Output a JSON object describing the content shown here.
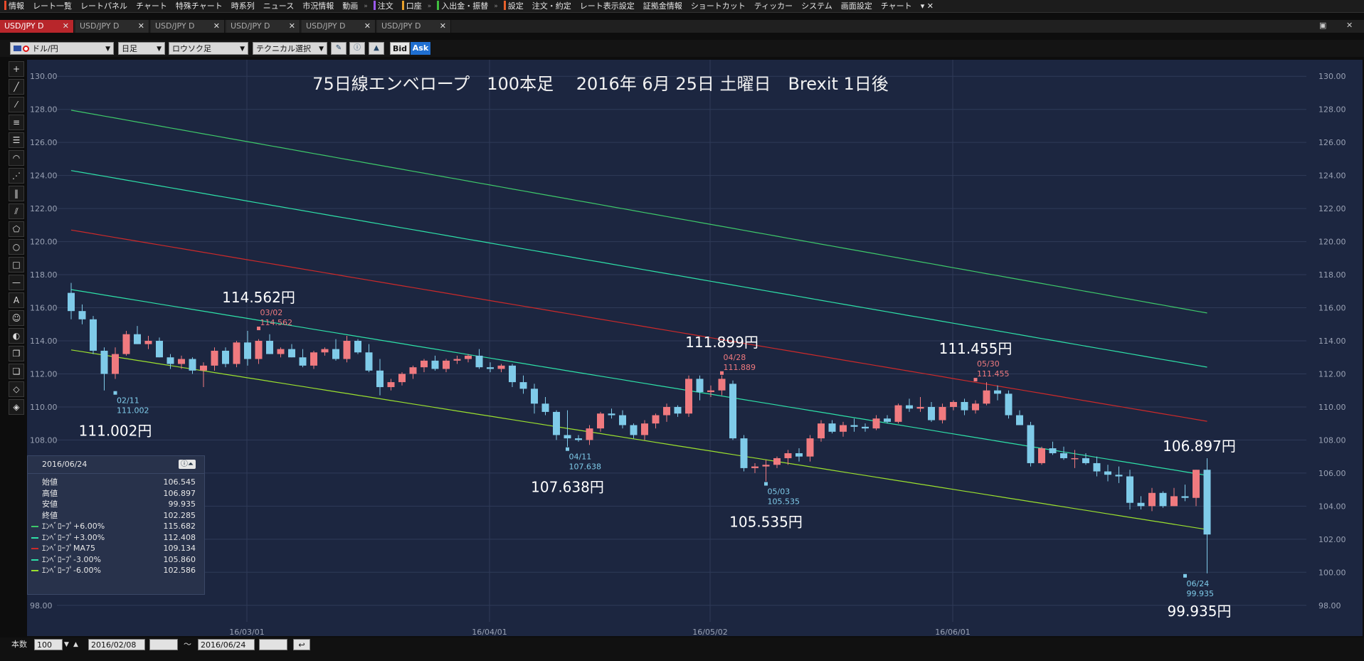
{
  "menubar": {
    "items": [
      {
        "label": "情報",
        "color": "#e84a2b"
      },
      {
        "label": "レート一覧",
        "color": ""
      },
      {
        "label": "レートパネル",
        "color": ""
      },
      {
        "label": "チャート",
        "color": ""
      },
      {
        "label": "特殊チャート",
        "color": ""
      },
      {
        "label": "時系列",
        "color": ""
      },
      {
        "label": "ニュース",
        "color": ""
      },
      {
        "label": "市況情報",
        "color": ""
      },
      {
        "label": "動画",
        "color": ""
      },
      {
        "label": "注文",
        "color": "#9b59f5"
      },
      {
        "label": "口座",
        "color": "#e8a02b"
      },
      {
        "label": "入出金・振替",
        "color": "#3fbf3f"
      },
      {
        "label": "設定",
        "color": "#e8602b"
      },
      {
        "label": "注文・約定",
        "color": ""
      },
      {
        "label": "レート表示設定",
        "color": ""
      },
      {
        "label": "証拠金情報",
        "color": ""
      },
      {
        "label": "ショートカット",
        "color": ""
      },
      {
        "label": "ティッカー",
        "color": ""
      },
      {
        "label": "システム",
        "color": ""
      },
      {
        "label": "画面設定",
        "color": ""
      },
      {
        "label": "チャート",
        "color": ""
      }
    ]
  },
  "tabs": [
    {
      "label": "USD/JPY D",
      "active": true
    },
    {
      "label": "USD/JPY D",
      "active": false
    },
    {
      "label": "USD/JPY D",
      "active": false
    },
    {
      "label": "USD/JPY D",
      "active": false
    },
    {
      "label": "USD/JPY D",
      "active": false
    },
    {
      "label": "USD/JPY D",
      "active": false
    }
  ],
  "toolbar": {
    "symbol": "ドル/円",
    "period": "日足",
    "chart_style": "ロウソク足",
    "technical": "テクニカル選択",
    "bid": "Bid",
    "ask": "Ask"
  },
  "colors": {
    "bull": "#f07a7f",
    "bear": "#7fcbe9",
    "ma": "#cc2a2a",
    "env_p6": "#3ec86a",
    "env_p3": "#2ee0a8",
    "env_m3": "#2ee0a8",
    "env_m6": "#9be02e"
  },
  "chart_data": {
    "type": "candlestick",
    "title": "75日線エンベロープ　100本足　 2016年 6月 25日 土曜日　Brexit 1日後",
    "ylim": [
      97.0,
      131.0
    ],
    "y_ticks": [
      "130.00",
      "128.00",
      "126.00",
      "124.00",
      "122.00",
      "120.00",
      "118.00",
      "116.00",
      "114.00",
      "112.00",
      "110.00",
      "108.00",
      "106.00",
      "104.00",
      "102.00",
      "100.00",
      "98.00"
    ],
    "x_ticks": [
      {
        "label": "16/03/01",
        "index": 16
      },
      {
        "label": "16/04/01",
        "index": 38
      },
      {
        "label": "16/05/02",
        "index": 58
      },
      {
        "label": "16/06/01",
        "index": 80
      }
    ],
    "candles": [
      [
        116.9,
        117.5,
        115.3,
        115.8
      ],
      [
        115.8,
        116.2,
        115.0,
        115.3
      ],
      [
        115.3,
        115.5,
        113.2,
        113.4
      ],
      [
        113.4,
        113.6,
        111.0,
        112.0
      ],
      [
        112.0,
        113.6,
        111.7,
        113.2
      ],
      [
        113.2,
        114.6,
        113.1,
        114.4
      ],
      [
        114.4,
        114.9,
        113.8,
        113.8
      ],
      [
        113.8,
        114.3,
        113.5,
        114.0
      ],
      [
        114.0,
        114.2,
        113.0,
        113.0
      ],
      [
        113.0,
        113.2,
        112.3,
        112.6
      ],
      [
        112.6,
        113.1,
        112.3,
        112.9
      ],
      [
        112.9,
        113.0,
        112.0,
        112.2
      ],
      [
        112.2,
        112.7,
        111.2,
        112.5
      ],
      [
        112.5,
        113.6,
        112.2,
        113.4
      ],
      [
        113.4,
        113.6,
        112.4,
        112.6
      ],
      [
        112.6,
        114.0,
        112.4,
        113.9
      ],
      [
        113.9,
        114.6,
        112.5,
        112.9
      ],
      [
        112.9,
        114.1,
        112.6,
        114.0
      ],
      [
        114.0,
        114.4,
        113.2,
        113.2
      ],
      [
        113.2,
        113.6,
        113.0,
        113.5
      ],
      [
        113.5,
        113.8,
        113.0,
        113.0
      ],
      [
        113.0,
        113.5,
        112.4,
        112.5
      ],
      [
        112.5,
        113.4,
        112.3,
        113.3
      ],
      [
        113.3,
        113.6,
        113.1,
        113.5
      ],
      [
        113.5,
        114.1,
        112.8,
        112.9
      ],
      [
        112.9,
        114.3,
        112.7,
        114.0
      ],
      [
        114.0,
        114.1,
        113.2,
        113.3
      ],
      [
        113.3,
        113.8,
        112.1,
        112.2
      ],
      [
        112.2,
        112.9,
        110.7,
        111.2
      ],
      [
        111.2,
        111.7,
        111.0,
        111.5
      ],
      [
        111.5,
        112.1,
        111.3,
        112.0
      ],
      [
        112.0,
        112.5,
        111.7,
        112.4
      ],
      [
        112.4,
        112.9,
        112.1,
        112.8
      ],
      [
        112.8,
        113.1,
        112.2,
        112.3
      ],
      [
        112.3,
        112.9,
        112.1,
        112.8
      ],
      [
        112.8,
        113.1,
        112.6,
        112.9
      ],
      [
        112.9,
        113.2,
        112.7,
        113.1
      ],
      [
        113.1,
        113.5,
        112.3,
        112.4
      ],
      [
        112.4,
        112.7,
        112.1,
        112.3
      ],
      [
        112.3,
        112.6,
        112.1,
        112.5
      ],
      [
        112.5,
        112.6,
        111.2,
        111.5
      ],
      [
        111.5,
        111.9,
        110.8,
        111.1
      ],
      [
        111.1,
        111.4,
        109.6,
        110.2
      ],
      [
        110.2,
        110.6,
        109.5,
        109.7
      ],
      [
        109.7,
        109.8,
        108.0,
        108.3
      ],
      [
        108.3,
        109.8,
        107.6,
        108.1
      ],
      [
        108.1,
        108.3,
        107.9,
        108.0
      ],
      [
        108.0,
        108.9,
        107.7,
        108.7
      ],
      [
        108.7,
        109.7,
        108.5,
        109.6
      ],
      [
        109.6,
        109.9,
        109.3,
        109.5
      ],
      [
        109.5,
        109.8,
        108.7,
        108.9
      ],
      [
        108.9,
        109.0,
        108.1,
        108.3
      ],
      [
        108.3,
        109.2,
        108.0,
        109.0
      ],
      [
        109.0,
        109.6,
        108.7,
        109.5
      ],
      [
        109.5,
        110.2,
        109.1,
        110.0
      ],
      [
        110.0,
        110.1,
        109.4,
        109.6
      ],
      [
        109.6,
        111.9,
        109.4,
        111.7
      ],
      [
        111.7,
        111.9,
        110.4,
        110.9
      ],
      [
        110.9,
        111.3,
        110.6,
        111.0
      ],
      [
        111.0,
        111.9,
        110.7,
        111.7
      ],
      [
        111.4,
        111.6,
        108.0,
        108.1
      ],
      [
        108.1,
        108.3,
        106.1,
        106.3
      ],
      [
        106.3,
        106.6,
        106.0,
        106.4
      ],
      [
        106.4,
        106.8,
        105.5,
        106.5
      ],
      [
        106.5,
        107.0,
        106.3,
        106.9
      ],
      [
        106.9,
        107.4,
        106.5,
        107.2
      ],
      [
        107.2,
        107.5,
        106.7,
        107.0
      ],
      [
        107.0,
        108.3,
        106.7,
        108.1
      ],
      [
        108.1,
        109.2,
        107.9,
        109.0
      ],
      [
        109.0,
        109.2,
        108.4,
        108.5
      ],
      [
        108.5,
        109.1,
        108.2,
        108.9
      ],
      [
        108.9,
        109.3,
        108.5,
        108.8
      ],
      [
        108.8,
        109.0,
        108.5,
        108.7
      ],
      [
        108.7,
        109.5,
        108.6,
        109.3
      ],
      [
        109.3,
        109.5,
        109.0,
        109.1
      ],
      [
        109.1,
        110.2,
        109.0,
        110.1
      ],
      [
        110.1,
        110.5,
        109.7,
        109.9
      ],
      [
        109.9,
        110.6,
        109.7,
        110.0
      ],
      [
        110.0,
        110.3,
        109.1,
        109.2
      ],
      [
        109.2,
        110.2,
        109.0,
        110.0
      ],
      [
        110.0,
        110.4,
        109.8,
        110.3
      ],
      [
        110.3,
        110.5,
        109.5,
        109.8
      ],
      [
        109.8,
        110.4,
        109.6,
        110.2
      ],
      [
        110.2,
        111.5,
        110.1,
        111.0
      ],
      [
        111.0,
        111.3,
        110.4,
        110.8
      ],
      [
        110.8,
        111.0,
        109.3,
        109.5
      ],
      [
        109.5,
        109.8,
        108.9,
        108.9
      ],
      [
        108.9,
        109.1,
        106.4,
        106.6
      ],
      [
        106.6,
        107.6,
        106.5,
        107.5
      ],
      [
        107.5,
        107.9,
        107.1,
        107.2
      ],
      [
        107.2,
        107.6,
        106.8,
        106.9
      ],
      [
        106.9,
        107.4,
        106.3,
        106.9
      ],
      [
        106.9,
        107.2,
        106.5,
        106.6
      ],
      [
        106.6,
        107.0,
        105.8,
        106.1
      ],
      [
        106.1,
        106.5,
        105.5,
        105.9
      ],
      [
        105.9,
        106.4,
        105.4,
        105.8
      ],
      [
        105.8,
        106.2,
        103.8,
        104.2
      ],
      [
        104.2,
        104.6,
        103.8,
        104.0
      ],
      [
        104.0,
        105.1,
        103.7,
        104.8
      ],
      [
        104.8,
        104.9,
        103.9,
        104.0
      ],
      [
        104.0,
        105.1,
        104.0,
        104.6
      ],
      [
        104.6,
        105.3,
        104.3,
        104.5
      ],
      [
        104.5,
        106.2,
        104.0,
        106.2
      ],
      [
        106.2,
        106.897,
        99.935,
        102.285
      ]
    ],
    "envelopes": [
      {
        "name": "MA75",
        "color_key": "ma",
        "start": 120.7,
        "end": 109.134
      },
      {
        "name": "+6.00%",
        "color_key": "env_p6",
        "start": 127.95,
        "end": 115.682
      },
      {
        "name": "+3.00%",
        "color_key": "env_p3",
        "start": 124.3,
        "end": 112.408
      },
      {
        "name": "-3.00%",
        "color_key": "env_m3",
        "start": 117.1,
        "end": 105.86
      },
      {
        "name": "-6.00%",
        "color_key": "env_m6",
        "start": 113.45,
        "end": 102.586
      }
    ],
    "marks": [
      {
        "index": 4,
        "price": 111.0,
        "dir": "low",
        "date": "02/11",
        "value": "111.002",
        "big": "111.002円"
      },
      {
        "index": 17,
        "price": 114.6,
        "dir": "high",
        "date": "03/02",
        "value": "114.562",
        "big": "114.562円"
      },
      {
        "index": 45,
        "price": 107.6,
        "dir": "low",
        "date": "04/11",
        "value": "107.638",
        "big": "107.638円"
      },
      {
        "index": 59,
        "price": 111.9,
        "dir": "high",
        "date": "04/28",
        "value": "111.889",
        "big": "111.899円"
      },
      {
        "index": 63,
        "price": 105.5,
        "dir": "low",
        "date": "05/03",
        "value": "105.535",
        "big": "105.535円"
      },
      {
        "index": 82,
        "price": 111.5,
        "dir": "high",
        "date": "05/30",
        "value": "111.455",
        "big": "111.455円"
      },
      {
        "index": 101,
        "price": 106.897,
        "dir": "high",
        "date": "",
        "value": "",
        "big": "106.897円"
      },
      {
        "index": 101,
        "price": 99.935,
        "dir": "low",
        "date": "06/24",
        "value": "99.935",
        "big": "99.935円"
      }
    ]
  },
  "legend": {
    "date": "2016/06/24",
    "rows": [
      {
        "label": "始値",
        "value": "106.545",
        "color": ""
      },
      {
        "label": "高値",
        "value": "106.897",
        "color": ""
      },
      {
        "label": "安値",
        "value": "99.935",
        "color": ""
      },
      {
        "label": "終値",
        "value": "102.285",
        "color": ""
      },
      {
        "label": "ｴﾝﾍﾞﾛｰﾌﾟ+6.00%",
        "value": "115.682",
        "color": "#3ec86a"
      },
      {
        "label": "ｴﾝﾍﾞﾛｰﾌﾟ+3.00%",
        "value": "112.408",
        "color": "#2ee0a8"
      },
      {
        "label": "ｴﾝﾍﾞﾛｰﾌﾟMA75",
        "value": "109.134",
        "color": "#cc2a2a"
      },
      {
        "label": "ｴﾝﾍﾞﾛｰﾌﾟ-3.00%",
        "value": "105.860",
        "color": "#2ee0a8"
      },
      {
        "label": "ｴﾝﾍﾞﾛｰﾌﾟ-6.00%",
        "value": "102.586",
        "color": "#9be02e"
      }
    ]
  },
  "bottombar": {
    "count_label": "本数",
    "count_value": "100",
    "from_date": "2016/02/08",
    "tilde": "～",
    "to_date": "2016/06/24"
  }
}
